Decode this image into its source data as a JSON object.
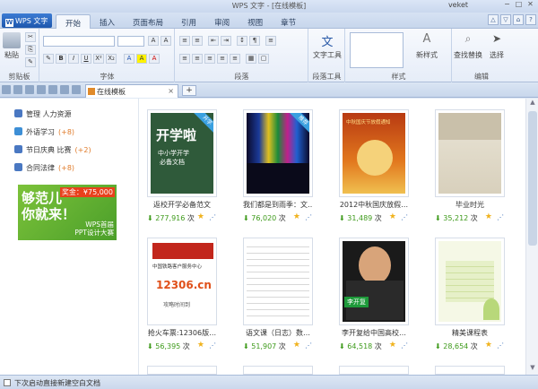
{
  "window": {
    "title": "WPS 文字 - [在线模板]",
    "user": "veket",
    "controls": [
      "−",
      "□",
      "✕"
    ]
  },
  "app_button": {
    "logo": "W",
    "label": "WPS 文字"
  },
  "menu_tabs": [
    "开始",
    "插入",
    "页面布局",
    "引用",
    "审阅",
    "视图",
    "章节"
  ],
  "quick_icons": [
    "△",
    "▽",
    "⌂",
    "?"
  ],
  "ribbon": {
    "groups": {
      "clipboard": "剪贴板",
      "font": "字体",
      "paragraph": "段落",
      "paragraph_tools": "段落工具",
      "styles": "样式",
      "edit": "编辑"
    },
    "paste": "粘贴",
    "text_tools": "文字工具",
    "new_style": "新样式",
    "find_replace": "查找替换",
    "select": "选择",
    "font_buttons": [
      "A",
      "A",
      "✎",
      "B",
      "I",
      "U",
      "X²",
      "X₂",
      "A",
      "A",
      "A"
    ]
  },
  "doc_tab": {
    "label": "在线模板",
    "close": "×",
    "new": "+"
  },
  "sidebar": {
    "items": [
      {
        "label": "管理 人力资源",
        "count": "",
        "color": "#4a78c2"
      },
      {
        "label": "外语学习",
        "count": "(+8)",
        "color": "#3d8fd6"
      },
      {
        "label": "节日庆典 比赛",
        "count": "(+2)",
        "color": "#4a78c2"
      },
      {
        "label": "合同法律",
        "count": "(+8)",
        "color": "#4a78c2"
      }
    ],
    "banner": {
      "line1": "够范儿",
      "line2": "你就来！",
      "prize": "奖金：¥75,000",
      "sub1": "WPS首届",
      "sub2": "PPT设计大赛"
    }
  },
  "templates": [
    {
      "name": "返校开学必备范文",
      "count": "277,916",
      "unit": "次",
      "tag": "开学"
    },
    {
      "name": "我们都是到雨季：文…",
      "count": "76,020",
      "unit": "次",
      "tag": "推荐"
    },
    {
      "name": "2012中秋国庆放假…",
      "count": "31,489",
      "unit": "次",
      "tag": ""
    },
    {
      "name": "毕业时光",
      "count": "35,212",
      "unit": "次",
      "tag": ""
    },
    {
      "name": "抢火车票:12306版…",
      "count": "56,395",
      "unit": "次",
      "tag": ""
    },
    {
      "name": "语文课（日志）数…",
      "count": "51,907",
      "unit": "次",
      "tag": ""
    },
    {
      "name": "李开复给中国高校…",
      "count": "64,518",
      "unit": "次",
      "tag": ""
    },
    {
      "name": "精美课程表",
      "count": "28,654",
      "unit": "次",
      "tag": ""
    }
  ],
  "thumb_text": {
    "t1_big": "开学啦",
    "t1_sub": "中小学开学",
    "t1_sub2": "必备文档",
    "t3_title": "中秋国庆节放假通知",
    "t5_site": "12306.cn",
    "t5_top": "中国铁路客户服务中心",
    "t5_bot": "攻略时间到",
    "t7_name": "李开复"
  },
  "statusbar": {
    "label": "下次启动直接新建空白文档"
  },
  "icons": {
    "download": "download-arrow-icon",
    "star": "star-icon",
    "share": "share-icon"
  }
}
